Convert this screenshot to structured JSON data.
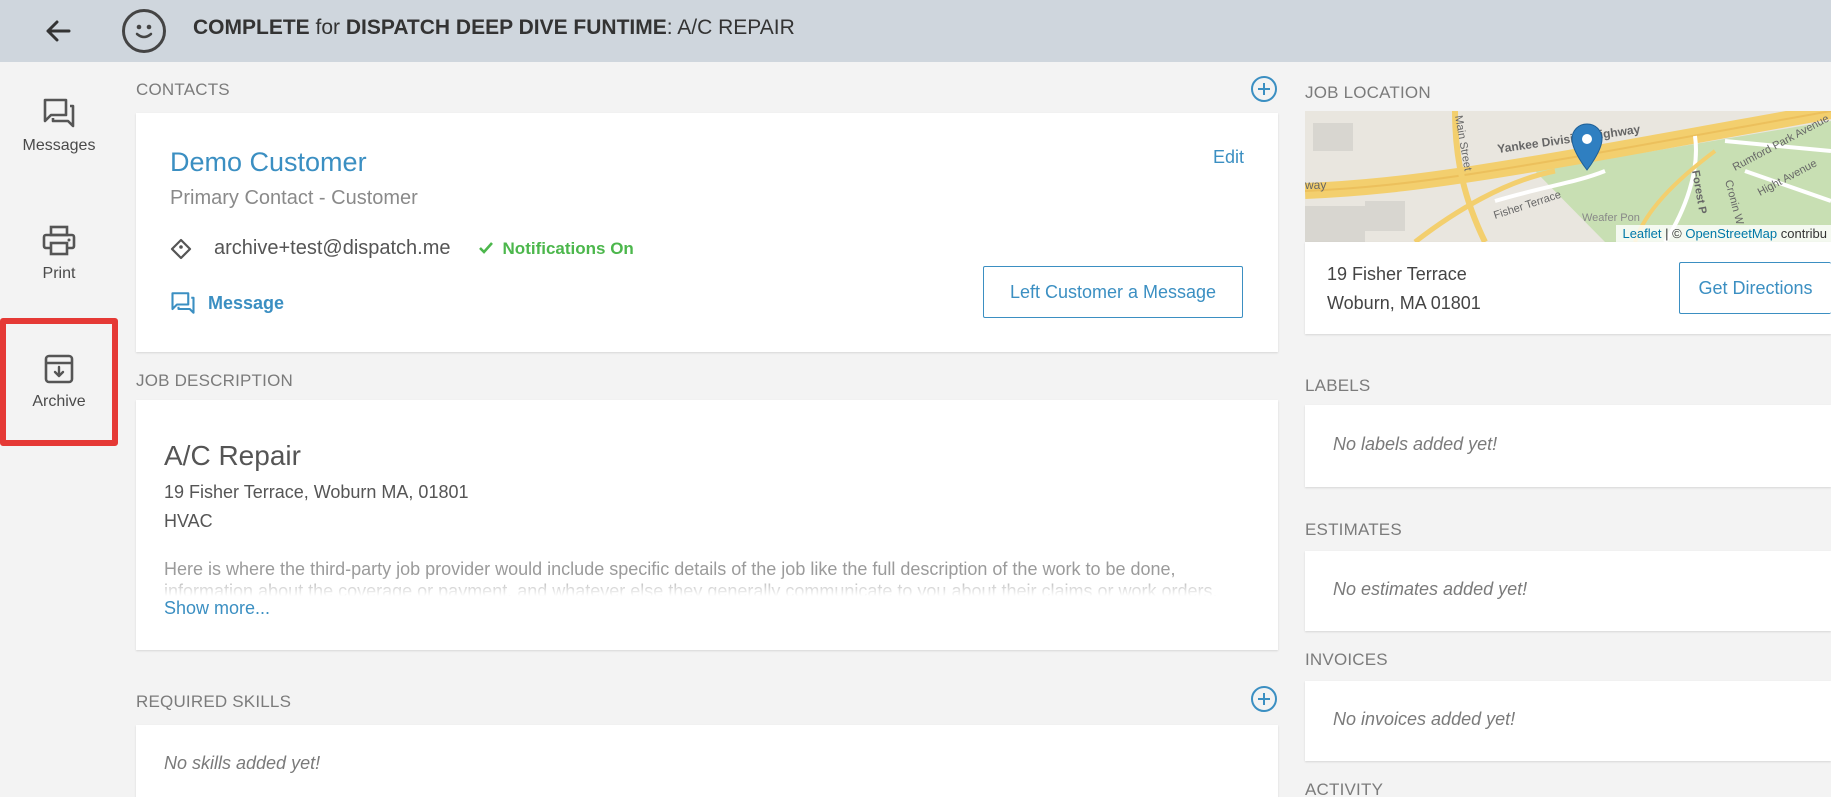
{
  "header": {
    "status": "COMPLETE",
    "for_text": "for",
    "customer": "DISPATCH DEEP DIVE FUNTIME",
    "separator": ":",
    "job": "A/C REPAIR"
  },
  "sidenav": {
    "items": [
      {
        "label": "Messages",
        "icon": "messages-icon"
      },
      {
        "label": "Print",
        "icon": "printer-icon"
      },
      {
        "label": "Archive",
        "icon": "archive-icon"
      }
    ],
    "highlight_color": "#e53935"
  },
  "contacts": {
    "section_label": "CONTACTS",
    "name": "Demo Customer",
    "subtitle": "Primary Contact - Customer",
    "edit_label": "Edit",
    "email": "archive+test@dispatch.me",
    "notifications": "Notifications On",
    "message_label": "Message",
    "left_message_button": "Left Customer a Message"
  },
  "job_description": {
    "section_label": "JOB DESCRIPTION",
    "title": "A/C Repair",
    "address": "19 Fisher Terrace, Woburn MA, 01801",
    "trade": "HVAC",
    "description": "Here is where the third-party job provider would include specific details of the job like the full description of the work to be done, information about the coverage or payment, and whatever else they generally communicate to you about their claims or work orders.",
    "show_more": "Show more..."
  },
  "required_skills": {
    "section_label": "REQUIRED SKILLS",
    "empty": "No skills added yet!"
  },
  "job_location": {
    "section_label": "JOB LOCATION",
    "address_line1": "19 Fisher Terrace",
    "address_line2": "Woburn, MA 01801",
    "directions_button": "Get Directions",
    "map_streets": [
      "Yankee Division Highway",
      "Main Street",
      "Fisher Terrace",
      "Rumford Park Avenue",
      "Hight Avenue",
      "Forest P",
      "Cronin W",
      "Weafer Pon",
      "way"
    ],
    "attribution": {
      "leaflet": "Leaflet",
      "sep": "| ©",
      "osm": "OpenStreetMap",
      "contrib": "contribu"
    }
  },
  "labels": {
    "section_label": "LABELS",
    "empty": "No labels added yet!"
  },
  "estimates": {
    "section_label": "ESTIMATES",
    "empty": "No estimates added yet!"
  },
  "invoices": {
    "section_label": "INVOICES",
    "empty": "No invoices added yet!"
  },
  "activity": {
    "section_label": "ACTIVITY"
  },
  "colors": {
    "accent": "#3b8fc2",
    "success": "#4cb74c",
    "topbar": "#cfd6dd"
  }
}
